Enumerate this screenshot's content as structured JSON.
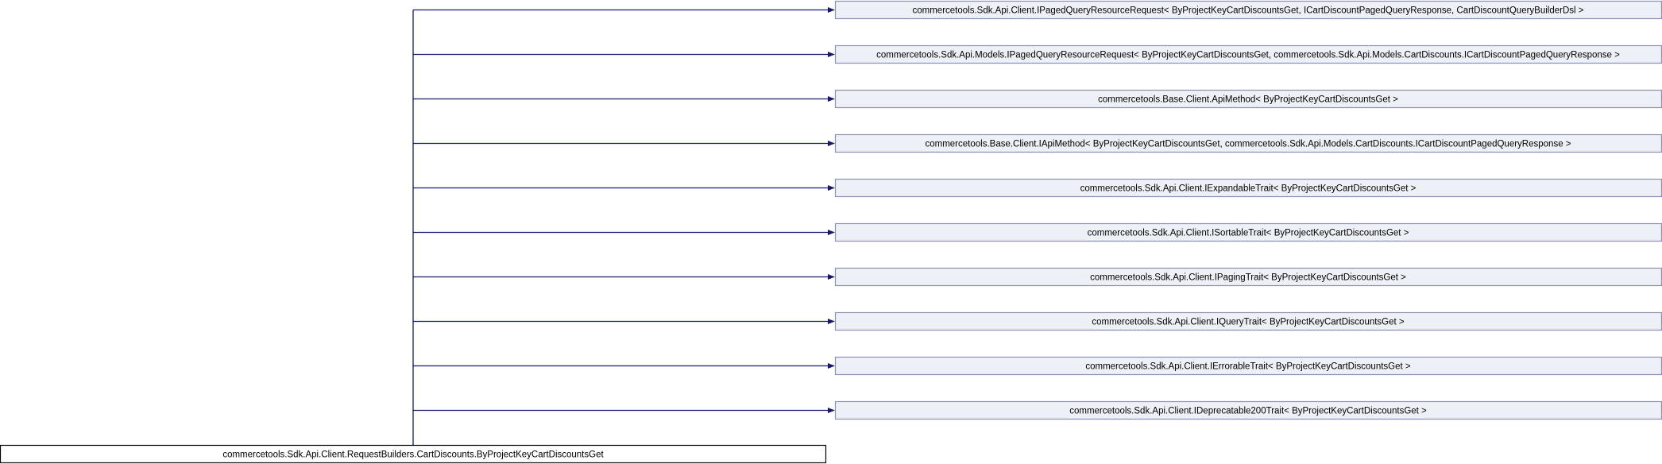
{
  "diagram": {
    "derived_class": "commercetools.Sdk.Api.Client.RequestBuilders.CartDiscounts.ByProjectKeyCartDiscountsGet",
    "base_classes": [
      "commercetools.Sdk.Api.Client.IPagedQueryResourceRequest< ByProjectKeyCartDiscountsGet, ICartDiscountPagedQueryResponse, CartDiscountQueryBuilderDsl >",
      "commercetools.Sdk.Api.Models.IPagedQueryResourceRequest< ByProjectKeyCartDiscountsGet, commercetools.Sdk.Api.Models.CartDiscounts.ICartDiscountPagedQueryResponse >",
      "commercetools.Base.Client.ApiMethod< ByProjectKeyCartDiscountsGet >",
      "commercetools.Base.Client.IApiMethod< ByProjectKeyCartDiscountsGet, commercetools.Sdk.Api.Models.CartDiscounts.ICartDiscountPagedQueryResponse >",
      "commercetools.Sdk.Api.Client.IExpandableTrait< ByProjectKeyCartDiscountsGet >",
      "commercetools.Sdk.Api.Client.ISortableTrait< ByProjectKeyCartDiscountsGet >",
      "commercetools.Sdk.Api.Client.IPagingTrait< ByProjectKeyCartDiscountsGet >",
      "commercetools.Sdk.Api.Client.IQueryTrait< ByProjectKeyCartDiscountsGet >",
      "commercetools.Sdk.Api.Client.IErrorableTrait< ByProjectKeyCartDiscountsGet >",
      "commercetools.Sdk.Api.Client.IDeprecatable200Trait< ByProjectKeyCartDiscountsGet >"
    ]
  },
  "colors": {
    "edge": "#191970",
    "base_fill": "#eef0f7",
    "base_border": "#8a8fb3",
    "derived_border": "#000000"
  }
}
